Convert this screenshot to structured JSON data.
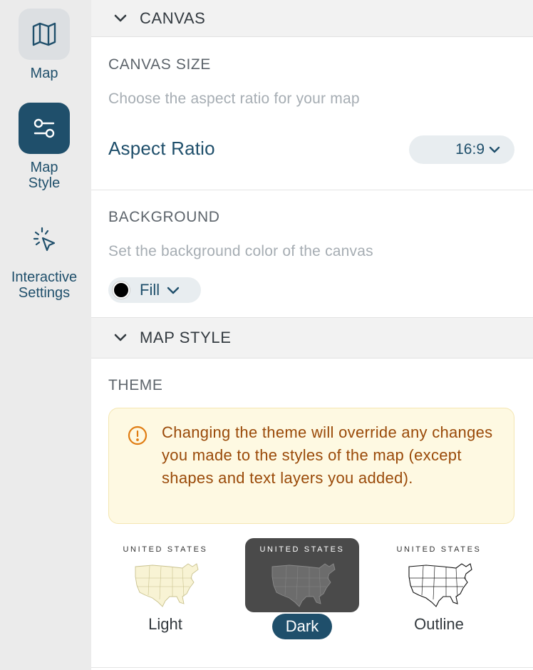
{
  "rail": {
    "items": [
      {
        "label": "Map",
        "icon": "map-icon",
        "selected": false
      },
      {
        "label": "Map\nStyle",
        "icon": "sliders-icon",
        "selected": true
      },
      {
        "label": "Interactive\nSettings",
        "icon": "cursor-click-icon",
        "selected": false
      }
    ]
  },
  "canvas_section": {
    "title": "CANVAS",
    "size": {
      "title": "CANVAS SIZE",
      "description": "Choose the aspect ratio for your map",
      "aspect_label": "Aspect Ratio",
      "aspect_value": "16:9"
    },
    "background": {
      "title": "BACKGROUND",
      "description": "Set the background color of the canvas",
      "fill_label": "Fill",
      "fill_color": "#000000"
    }
  },
  "map_style_section": {
    "title": "MAP STYLE",
    "theme_title": "THEME",
    "warning": "Changing the theme will override any changes you made to the styles of the map (except shapes and text layers you added).",
    "themes": [
      {
        "caption": "UNITED STATES",
        "label": "Light",
        "selected": false
      },
      {
        "caption": "UNITED STATES",
        "label": "Dark",
        "selected": true
      },
      {
        "caption": "UNITED STATES",
        "label": "Outline",
        "selected": false
      }
    ]
  },
  "colors": {
    "accent": "#1f4f6b",
    "warning_bg": "#fef9e2",
    "warning_text": "#9a4a09",
    "rail_bg": "#ebebeb"
  }
}
